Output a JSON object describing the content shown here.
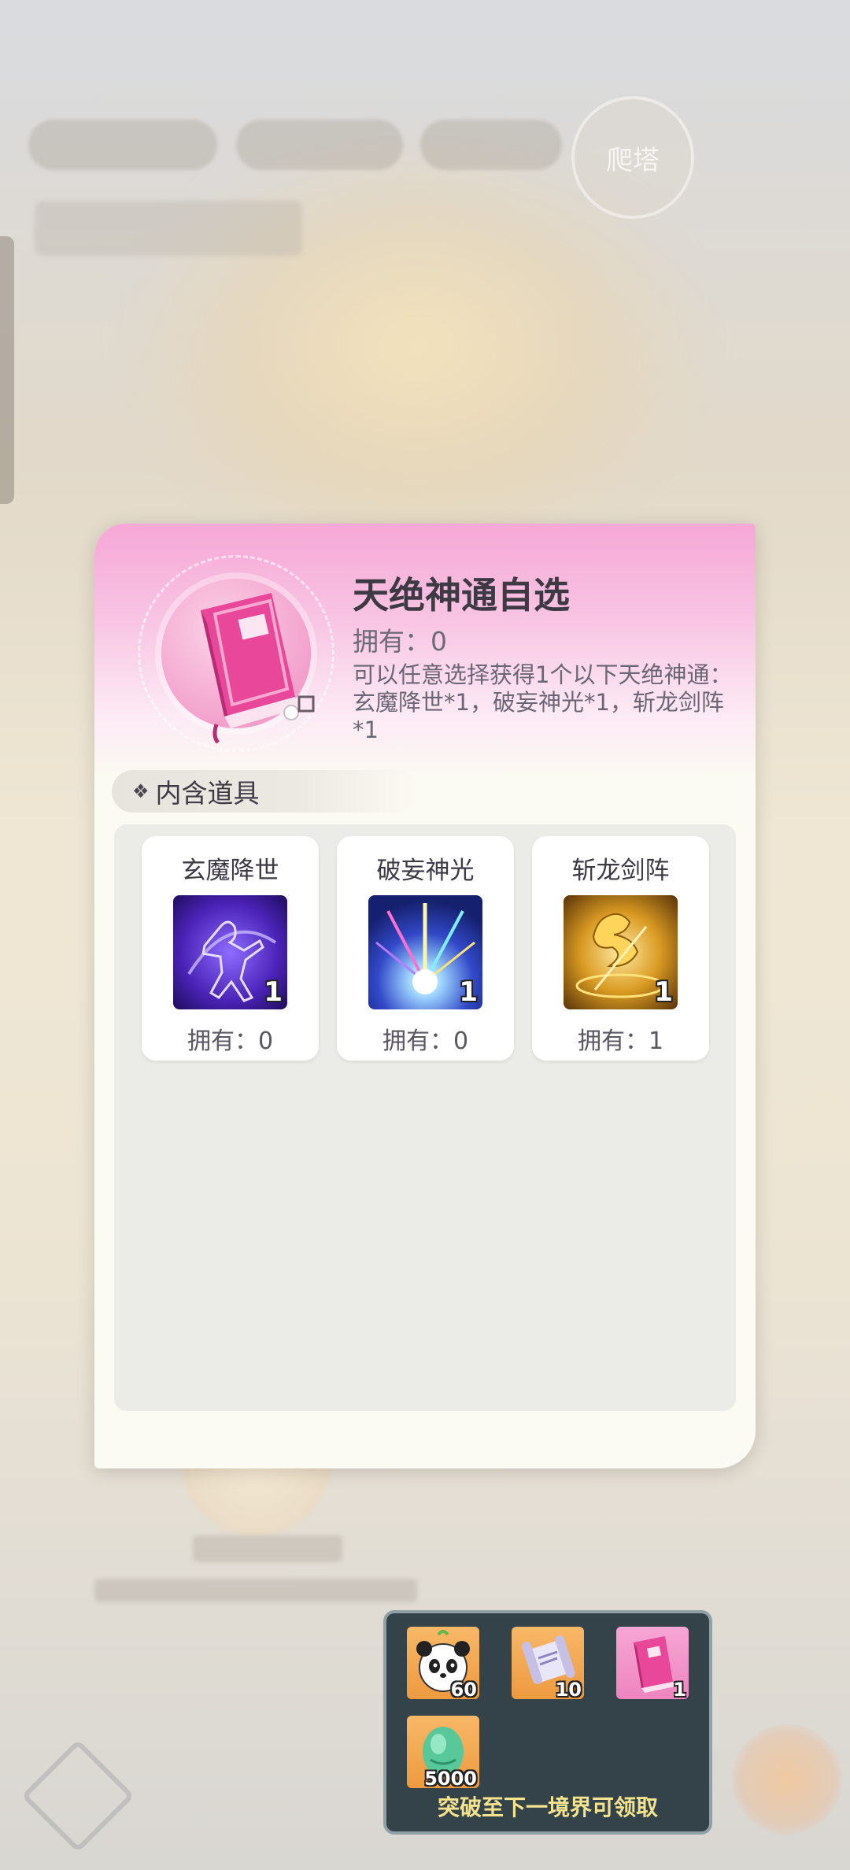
{
  "background": {
    "tower_button_label": "爬塔"
  },
  "popup": {
    "title": "天绝神通自选",
    "owned_text": "拥有：0",
    "description": "可以任意选择获得1个以下天绝神通：玄魔降世*1，破妄神光*1，斩龙剑阵*1",
    "section_label": "内含道具",
    "section_icon": "diamond-sparkle-icon",
    "items": [
      {
        "name": "玄魔降世",
        "count": "1",
        "owned": "拥有：0",
        "icon": "dark-demon-silhouette-icon",
        "color": "#5b2fc4"
      },
      {
        "name": "破妄神光",
        "count": "1",
        "owned": "拥有：0",
        "icon": "divine-light-burst-icon",
        "color": "#3a4fd0"
      },
      {
        "name": "斩龙剑阵",
        "count": "1",
        "owned": "拥有：1",
        "icon": "golden-dragon-icon",
        "color": "#d79a1e"
      }
    ]
  },
  "reward_tooltip": {
    "caption": "突破至下一境界可领取",
    "rewards": [
      {
        "icon": "panda-icon",
        "count": "60"
      },
      {
        "icon": "scroll-icon",
        "count": "10"
      },
      {
        "icon": "pink-book-icon",
        "count": "1"
      },
      {
        "icon": "green-spirit-egg-icon",
        "count": "5000"
      }
    ]
  }
}
